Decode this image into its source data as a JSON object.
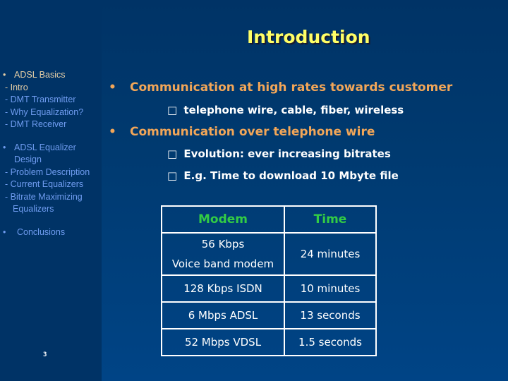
{
  "slide": {
    "title": "Introduction",
    "page_number": "3"
  },
  "sidebar": {
    "sections": [
      {
        "bullet": "•",
        "label": "ADSL Basics",
        "items": [
          "- Intro",
          "- DMT Transmitter",
          "- Why Equalization?",
          "- DMT Receiver"
        ],
        "active_items": [
          0
        ]
      },
      {
        "bullet": "•",
        "label": "ADSL Equalizer",
        "label_cont": "Design",
        "items": [
          "- Problem Description",
          "- Current Equalizers",
          "- Bitrate Maximizing"
        ],
        "item_cont": "Equalizers"
      },
      {
        "bullet": "•",
        "label": "Conclusions"
      }
    ]
  },
  "content": {
    "bullets": [
      {
        "marker": "•",
        "text": "Communication at high rates towards customer",
        "subitems": [
          {
            "marker": "□",
            "text": "telephone wire, cable, fiber, wireless"
          }
        ]
      },
      {
        "marker": "•",
        "text": "Communication over telephone wire",
        "subitems": [
          {
            "marker": "□",
            "text": "Evolution: ever increasing bitrates"
          },
          {
            "marker": "□",
            "text": "E.g. Time to download 10 Mbyte file"
          }
        ]
      }
    ],
    "table": {
      "headers": [
        "Modem",
        "Time"
      ],
      "rows": [
        {
          "modem": "56 Kbps",
          "modem_sub": "Voice band modem",
          "time": "24 minutes"
        },
        {
          "modem": "128 Kbps ISDN",
          "time": "10 minutes"
        },
        {
          "modem": "6 Mbps ADSL",
          "time": "13 seconds"
        },
        {
          "modem": "52 Mbps VDSL",
          "time": "1.5 seconds"
        }
      ]
    }
  },
  "colors": {
    "background": "#003366",
    "title": "#ffff66",
    "bullet_heading": "#f2a658",
    "sidebar_active": "#e6cfa6",
    "sidebar_inactive": "#6f9cf0",
    "table_header": "#33cc44",
    "text": "#ffffff"
  }
}
